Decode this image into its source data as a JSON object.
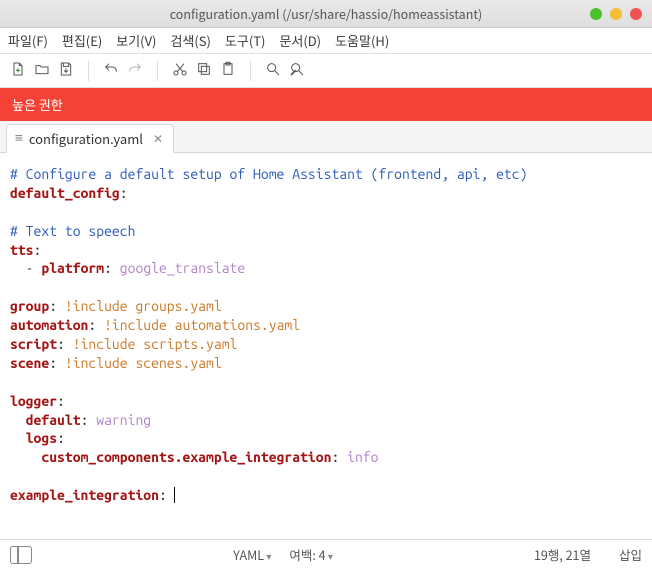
{
  "window": {
    "title": "configuration.yaml (/usr/share/hassio/homeassistant)"
  },
  "menu": {
    "file": "파일(F)",
    "edit": "편집(E)",
    "view": "보기(V)",
    "search": "검색(S)",
    "tools": "도구(T)",
    "document": "문서(D)",
    "help": "도움말(H)"
  },
  "banner": {
    "text": "높은 권한"
  },
  "tab": {
    "label": "configuration.yaml"
  },
  "code": {
    "comment1": "# Configure a default setup of Home Assistant (frontend, api, etc)",
    "default_config_key": "default_config",
    "comment2": "# Text to speech",
    "tts_key": "tts",
    "tts_platform_key": "platform",
    "tts_platform_val": "google_translate",
    "group_key": "group",
    "group_val": "!include groups.yaml",
    "automation_key": "automation",
    "automation_val": "!include automations.yaml",
    "script_key": "script",
    "script_val": "!include scripts.yaml",
    "scene_key": "scene",
    "scene_val": "!include scenes.yaml",
    "logger_key": "logger",
    "logger_default_key": "default",
    "logger_default_val": "warning",
    "logger_logs_key": "logs",
    "logger_custom_key": "custom_components.example_integration",
    "logger_custom_val": "info",
    "example_key": "example_integration"
  },
  "status": {
    "lang": "YAML",
    "spaces_label": "여백: 4",
    "position": "19행, 21열",
    "mode": "삽입"
  }
}
